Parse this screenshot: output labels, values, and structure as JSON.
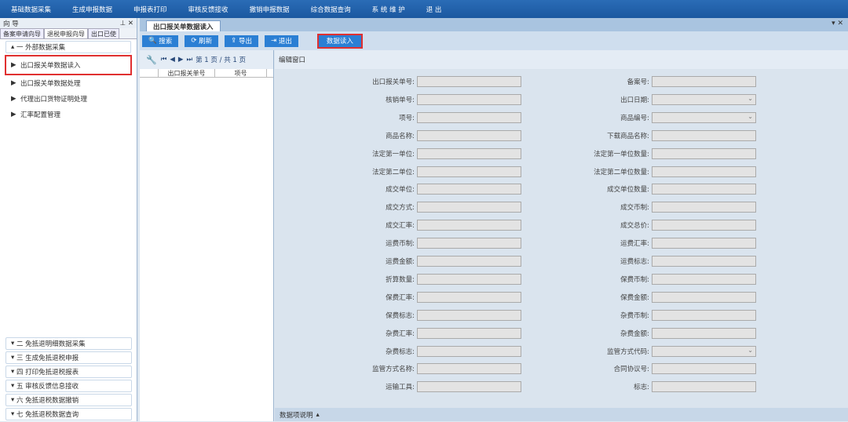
{
  "menu": [
    "基础数据采集",
    "生成申报数据",
    "申报表打印",
    "审核反馈接收",
    "撤销申报数据",
    "综合数据查询",
    "系 统 维 护",
    "退 出"
  ],
  "left": {
    "title": "向 导",
    "tabs": [
      "备案申请向导",
      "退税申报向导",
      "出口已使"
    ],
    "groups": [
      {
        "label": "一 外部数据采集",
        "items": [
          "出口报关单数据读入",
          "出口报关单数据处理",
          "代理出口货物证明处理",
          "汇率配置管理"
        ]
      }
    ],
    "collapsed": [
      "二 免抵退明细数据采集",
      "三 生成免抵退税申报",
      "四 打印免抵退税报表",
      "五 审核反馈信息接收",
      "六 免抵退税数据撤销",
      "七 免抵退税数据查询"
    ]
  },
  "tab": "出口报关单数据读入",
  "toolbar": {
    "search": "搜索",
    "refresh": "刷新",
    "export": "导出",
    "exit": "退出",
    "read": "数据读入"
  },
  "pager": {
    "text": "第 1 页 / 共 1 页"
  },
  "grid": {
    "columns": [
      "",
      "出口报关单号",
      "项号"
    ]
  },
  "form": {
    "title": "编辑窗口",
    "left": [
      "出口报关单号:",
      "核销单号:",
      "项号:",
      "商品名称:",
      "法定第一单位:",
      "法定第二单位:",
      "成交单位:",
      "成交方式:",
      "成交汇率:",
      "运费币制:",
      "运费金额:",
      "折算数量:",
      "保费汇率:",
      "保费标志:",
      "杂费汇率:",
      "杂费标志:",
      "监管方式名称:",
      "运输工具:"
    ],
    "right": [
      "备案号:",
      "出口日期:",
      "商品编号:",
      "下载商品名称:",
      "法定第一单位数量:",
      "法定第二单位数量:",
      "成交单位数量:",
      "成交币制:",
      "成交总价:",
      "运费汇率:",
      "运费标志:",
      "保费币制:",
      "保费金额:",
      "杂费币制:",
      "杂费金额:",
      "监管方式代码:",
      "合同协议号:",
      "标志:"
    ],
    "right_selects": [
      1,
      2,
      15
    ]
  },
  "bottom": "数据项说明"
}
